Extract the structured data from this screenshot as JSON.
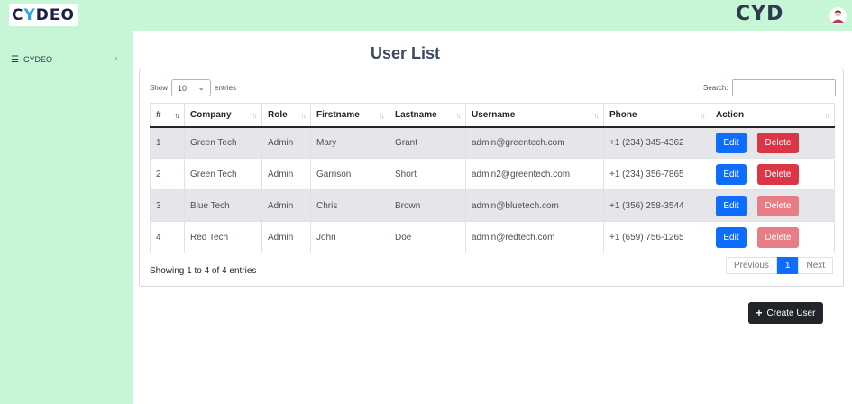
{
  "header": {
    "logo_text_a": "C",
    "logo_text_y": "Y",
    "logo_text_b": "DEO",
    "brand_right": "CYD"
  },
  "sidebar": {
    "items": [
      {
        "label": "CYDEO"
      }
    ]
  },
  "page": {
    "title": "User List"
  },
  "controls": {
    "show_label": "Show",
    "entries_value": "10",
    "entries_label": "entries",
    "search_label": "Search:"
  },
  "table": {
    "columns": [
      "#",
      "Company",
      "Role",
      "Firstname",
      "Lastname",
      "Username",
      "Phone",
      "Action"
    ],
    "rows": [
      {
        "num": "1",
        "company": "Green Tech",
        "role": "Admin",
        "first": "Mary",
        "last": "Grant",
        "user": "admin@greentech.com",
        "phone": "+1 (234) 345-4362",
        "edit": "Edit",
        "delete": "Delete"
      },
      {
        "num": "2",
        "company": "Green Tech",
        "role": "Admin",
        "first": "Garrison",
        "last": "Short",
        "user": "admin2@greentech.com",
        "phone": "+1 (234) 356-7865",
        "edit": "Edit",
        "delete": "Delete"
      },
      {
        "num": "3",
        "company": "Blue Tech",
        "role": "Admin",
        "first": "Chris",
        "last": "Brown",
        "user": "admin@bluetech.com",
        "phone": "+1 (356) 258-3544",
        "edit": "Edit",
        "delete": "Delete"
      },
      {
        "num": "4",
        "company": "Red Tech",
        "role": "Admin",
        "first": "John",
        "last": "Doe",
        "user": "admin@redtech.com",
        "phone": "+1 (659) 756-1265",
        "edit": "Edit",
        "delete": "Delete"
      }
    ]
  },
  "footer": {
    "info": "Showing 1 to 4 of 4 entries",
    "prev": "Previous",
    "page": "1",
    "next": "Next"
  },
  "actions": {
    "create_label": "Create User"
  },
  "colors": {
    "sidebar_bg": "#c6f6d5",
    "edit": "#0d6efd",
    "delete": "#dc3545",
    "delete_disabled": "#e87d86",
    "create": "#212529"
  }
}
